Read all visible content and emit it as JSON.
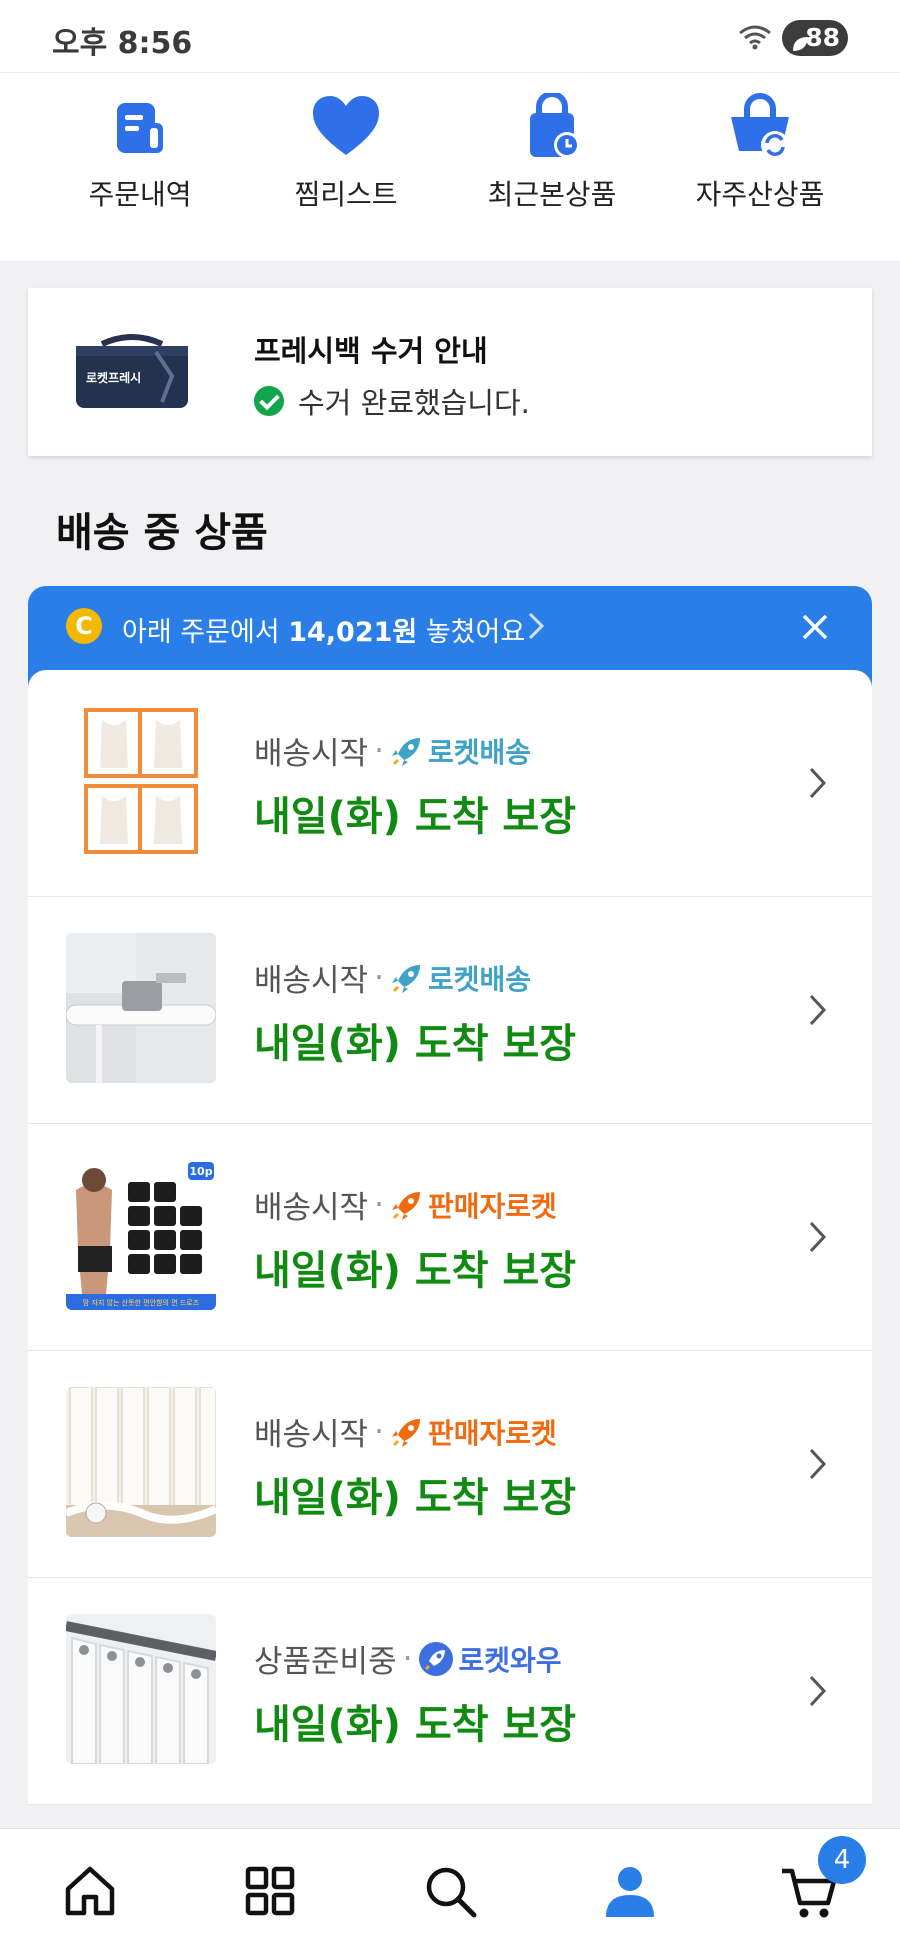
{
  "status_bar": {
    "time": "오후 8:56",
    "battery": "88"
  },
  "quick_menu": [
    {
      "label": "주문내역",
      "icon": "receipt-icon"
    },
    {
      "label": "찜리스트",
      "icon": "heart-icon"
    },
    {
      "label": "최근본상품",
      "icon": "recent-bag-icon"
    },
    {
      "label": "자주산상품",
      "icon": "reorder-basket-icon"
    }
  ],
  "fresh_bag": {
    "title": "프레시백 수거 안내",
    "status": "수거 완료했습니다.",
    "bag_text": "로켓프레시"
  },
  "section_title": "배송 중 상품",
  "banner": {
    "coin": "C",
    "text_before": "아래 주문에서 ",
    "amount": "14,021원",
    "text_after": " 놓쳤어요"
  },
  "orders": [
    {
      "status": "배송시작",
      "badge": "로켓배송",
      "badge_color": "#3fa3c8",
      "eta": "내일(화) 도착 보장",
      "thumb": "undershirt-pack"
    },
    {
      "status": "배송시작",
      "badge": "로켓배송",
      "badge_color": "#3fa3c8",
      "eta": "내일(화) 도착 보장",
      "thumb": "curtain-rod"
    },
    {
      "status": "배송시작",
      "badge": "판매자로켓",
      "badge_color": "#f06a0f",
      "eta": "내일(화) 도착 보장",
      "thumb": "boxer-briefs",
      "thumb_tag": "10p",
      "thumb_caption": "맘 자지 않는 산뜻한 편안함의 면 드로즈"
    },
    {
      "status": "배송시작",
      "badge": "판매자로켓",
      "badge_color": "#f06a0f",
      "eta": "내일(화) 도착 보장",
      "thumb": "sheer-curtain"
    },
    {
      "status": "상품준비중",
      "badge": "로켓와우",
      "badge_color": "#3d6fe0",
      "eta": "내일(화) 도착 보장",
      "thumb": "eyelet-curtain"
    }
  ],
  "tabbar": {
    "items": [
      "home-icon",
      "category-grid-icon",
      "search-icon",
      "my-coupang-icon",
      "cart-icon"
    ],
    "cart_count": "4",
    "active_color": "#2a7ee8"
  }
}
